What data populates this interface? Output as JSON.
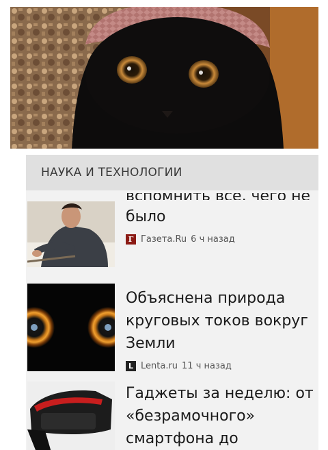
{
  "section": {
    "title": "НАУКА И ТЕХНОЛОГИИ"
  },
  "news": [
    {
      "title_partial": "вспомнить всё, чего не",
      "title": "было",
      "source": "Газета.Ru",
      "time": "6 ч назад",
      "source_icon": "gazeta-icon",
      "source_color": "#8b1a14"
    },
    {
      "title": "Объяснена природа\nкруговых токов вокруг\nЗемли",
      "source": "Lenta.ru",
      "time": "11 ч назад",
      "source_icon": "lenta-icon",
      "source_color": "#222222"
    },
    {
      "title": "Гаджеты за неделю: от\n«безрамочного»\nсмартфона до",
      "source": "",
      "time": ""
    }
  ]
}
